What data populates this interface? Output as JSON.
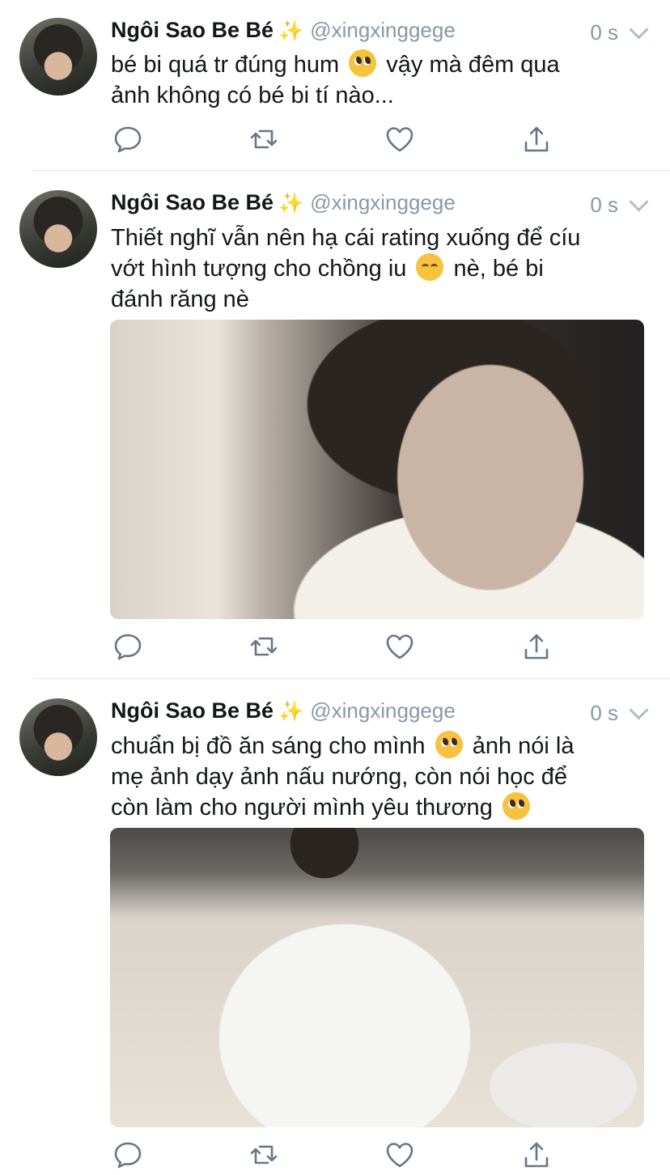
{
  "tweets": [
    {
      "name": "Ngôi Sao Be Bé",
      "sparkle": "✨",
      "handle": "@xingxinggege",
      "time": "0 s",
      "lines": [
        "bé bi quá tr đúng hum",
        "vậy mà đêm qua",
        "ảnh không có bé bi tí nào..."
      ]
    },
    {
      "name": "Ngôi Sao Be Bé",
      "sparkle": "✨",
      "handle": "@xingxinggege",
      "time": "0 s",
      "lines": [
        "Thiết nghĩ vẫn nên hạ cái rating xuống để cíu",
        "vớt hình tượng cho chồng iu",
        "nè, bé bi",
        "đánh răng nè"
      ]
    },
    {
      "name": "Ngôi Sao Be Bé",
      "sparkle": "✨",
      "handle": "@xingxinggege",
      "time": "0 s",
      "lines": [
        "chuẩn bị đồ ăn sáng cho mình",
        "ảnh nói là",
        "mẹ ảnh dạy ảnh nấu nướng, còn nói học để",
        "còn làm cho người mình yêu thương"
      ]
    }
  ],
  "icons": {
    "reply": "reply-icon",
    "retweet": "retweet-icon",
    "like": "heart-icon",
    "share": "share-icon"
  },
  "colors": {
    "text": "#14171a",
    "muted": "#8899a6",
    "icon": "#657786",
    "divider": "#e1e8ed"
  }
}
